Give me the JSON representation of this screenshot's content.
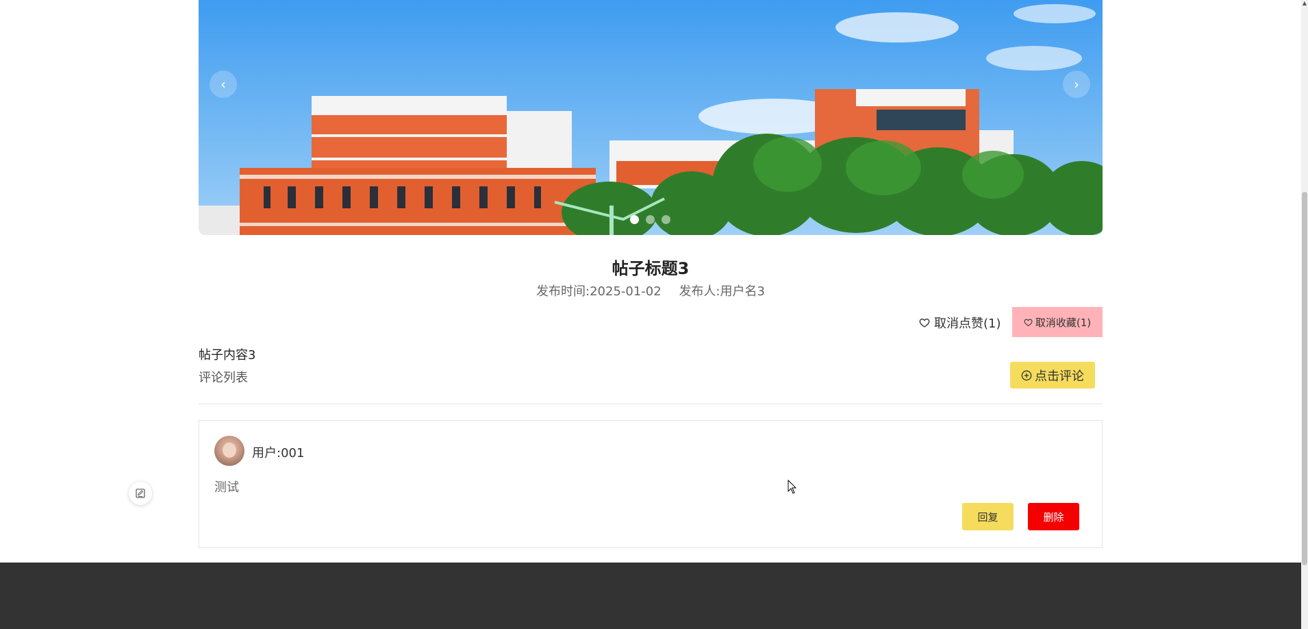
{
  "carousel": {
    "prev_label": "‹",
    "next_label": "›",
    "dots": [
      true,
      false,
      false
    ]
  },
  "post": {
    "title": "帖子标题3",
    "publish_time_label": "发布时间:",
    "publish_time": "2025-01-02",
    "publisher_label": "发布人:",
    "publisher": "用户名3",
    "content": "帖子内容3"
  },
  "actions": {
    "like_label": "取消点赞(1)",
    "favorite_label": "取消收藏(1)",
    "comment_button_label": "点击评论",
    "comment_list_title": "评论列表"
  },
  "comments": [
    {
      "user": "用户:001",
      "text": "测试",
      "reply_label": "回复",
      "delete_label": "删除"
    }
  ],
  "colors": {
    "accent_yellow": "#f5dc5c",
    "favorite_pink": "#ffb3b8",
    "delete_red": "#f50000",
    "footer": "#333333"
  }
}
